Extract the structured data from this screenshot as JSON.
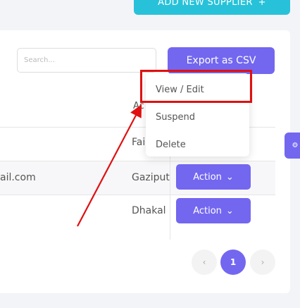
{
  "header": {
    "add_supplier_label": "ADD NEW SUPPLIER",
    "add_icon": "+"
  },
  "toolbar": {
    "search_placeholder": "Search...",
    "export_label": "Export as CSV"
  },
  "table": {
    "action_header": "Ac",
    "rows": [
      {
        "email": "",
        "location": "Fai"
      },
      {
        "email": "ail.com",
        "location": "Gaziput"
      },
      {
        "email": "",
        "location": "Dhakal"
      }
    ],
    "action_button_label": "Action",
    "action_chevron": "⌄"
  },
  "dropdown": {
    "items": [
      "View / Edit",
      "Suspend",
      "Delete"
    ]
  },
  "pagination": {
    "prev": "‹",
    "current": "1",
    "next": "›"
  },
  "side_tab_icon": "⚙",
  "colors": {
    "primary": "#7367f0",
    "cyan": "#27c2d9",
    "annotation": "#e01010"
  }
}
